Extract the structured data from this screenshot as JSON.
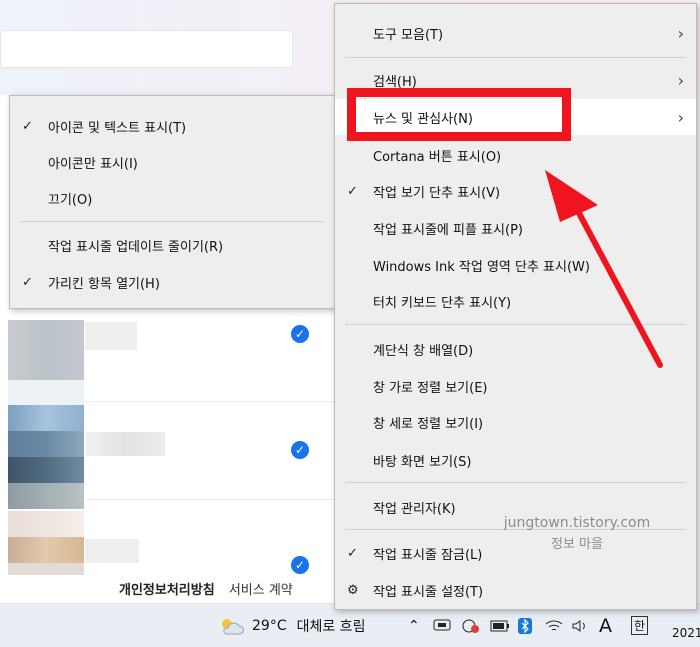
{
  "background": {
    "footer_privacy": "개인정보처리방침",
    "footer_terms": "서비스 계약"
  },
  "taskbar": {
    "temperature": "29°C",
    "weather": "대체로 흐림",
    "ime_letter": "A",
    "ime_lang": "한",
    "clock_year": "2021"
  },
  "main_menu": {
    "items": [
      {
        "label": "도구 모음(T)",
        "submenu": true
      },
      {
        "label": "검색(H)",
        "submenu": true
      },
      {
        "label": "뉴스 및 관심사(N)",
        "submenu": true
      },
      {
        "label": "Cortana 버튼 표시(O)"
      },
      {
        "label": "작업 보기 단추 표시(V)",
        "checked": true
      },
      {
        "label": "작업 표시줄에 피플 표시(P)"
      },
      {
        "label": "Windows Ink 작업 영역 단추 표시(W)"
      },
      {
        "label": "터치 키보드 단추 표시(Y)"
      },
      {
        "label": "계단식 창 배열(D)"
      },
      {
        "label": "창 가로 정렬 보기(E)"
      },
      {
        "label": "창 세로 정렬 보기(I)"
      },
      {
        "label": "바탕 화면 보기(S)"
      },
      {
        "label": "작업 관리자(K)"
      },
      {
        "label": "작업 표시줄 잠금(L)",
        "checked": true
      },
      {
        "label": "작업 표시줄 설정(T)",
        "icon": "gear-icon"
      }
    ]
  },
  "news_submenu": {
    "items": [
      {
        "label": "아이콘 및 텍스트 표시(T)",
        "checked": true
      },
      {
        "label": "아이콘만 표시(I)"
      },
      {
        "label": "끄기(O)"
      },
      {
        "label": "작업 표시줄 업데이트 줄이기(R)"
      },
      {
        "label": "가리킨 항목 열기(H)",
        "checked": true
      }
    ]
  },
  "watermark": {
    "line1": "jungtown.tistory.com",
    "line2": "정보 마을"
  },
  "annotation": {
    "color": "#f0141e"
  }
}
